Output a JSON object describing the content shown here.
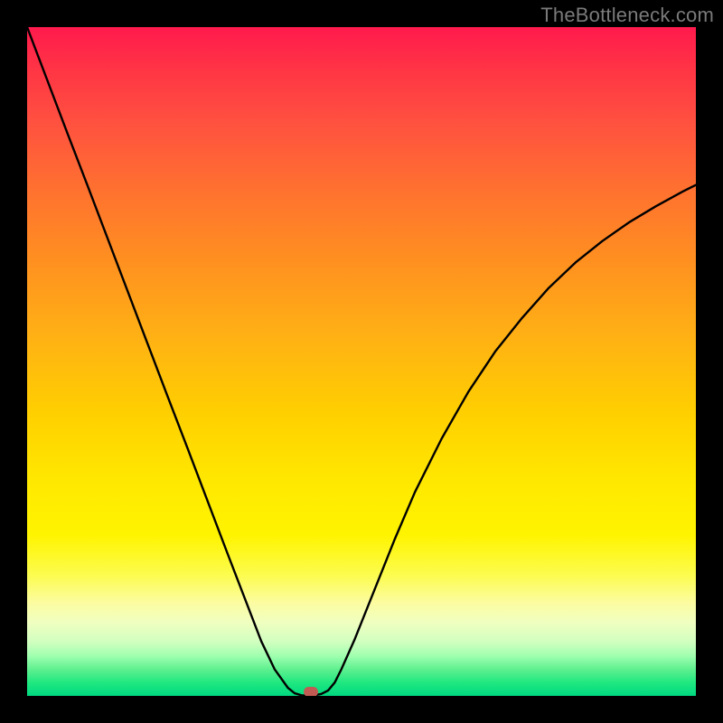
{
  "watermark": "TheBottleneck.com",
  "chart_data": {
    "type": "line",
    "title": "",
    "xlabel": "",
    "ylabel": "",
    "xlim": [
      0,
      1
    ],
    "ylim": [
      0,
      1
    ],
    "x": [
      0.0,
      0.03,
      0.06,
      0.09,
      0.12,
      0.15,
      0.18,
      0.21,
      0.24,
      0.27,
      0.3,
      0.33,
      0.35,
      0.37,
      0.39,
      0.4,
      0.41,
      0.42,
      0.43,
      0.44,
      0.45,
      0.46,
      0.47,
      0.49,
      0.52,
      0.55,
      0.58,
      0.62,
      0.66,
      0.7,
      0.74,
      0.78,
      0.82,
      0.86,
      0.9,
      0.94,
      0.98,
      1.0
    ],
    "values": [
      1.0,
      0.921,
      0.842,
      0.764,
      0.685,
      0.606,
      0.527,
      0.448,
      0.37,
      0.291,
      0.212,
      0.134,
      0.082,
      0.04,
      0.012,
      0.004,
      0.001,
      0.0,
      0.001,
      0.003,
      0.008,
      0.02,
      0.04,
      0.085,
      0.16,
      0.235,
      0.305,
      0.385,
      0.455,
      0.515,
      0.565,
      0.61,
      0.648,
      0.68,
      0.708,
      0.732,
      0.754,
      0.764
    ],
    "minimum_x": 0.42,
    "minimum_y": 0.0,
    "marker": {
      "x": 0.424,
      "y": 0.006,
      "color": "#c15a52"
    }
  },
  "colors": {
    "background": "#000000",
    "curve": "#000000",
    "marker": "#c15a52",
    "gradient_top": "#ff1a4d",
    "gradient_bottom": "#00d880"
  }
}
